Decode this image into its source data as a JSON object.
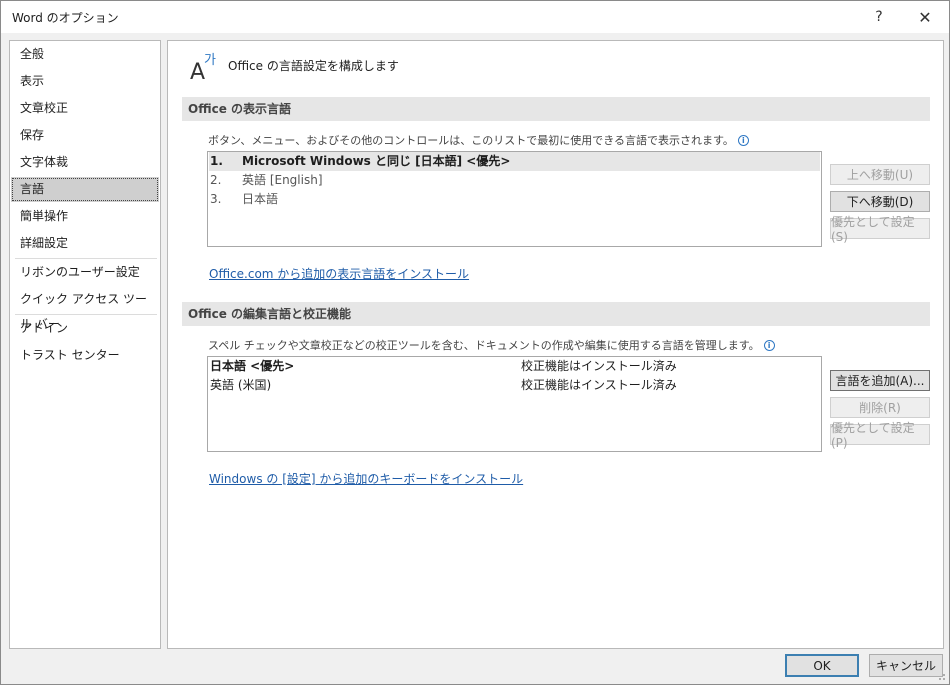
{
  "window": {
    "title": "Word のオプション",
    "help": "?",
    "close": "✕"
  },
  "sidebar": {
    "items": [
      {
        "label": "全般"
      },
      {
        "label": "表示"
      },
      {
        "label": "文章校正"
      },
      {
        "label": "保存"
      },
      {
        "label": "文字体裁"
      },
      {
        "label": "言語",
        "selected": true
      },
      {
        "label": "簡単操作"
      },
      {
        "label": "詳細設定"
      },
      {
        "label": "リボンのユーザー設定"
      },
      {
        "label": "クイック アクセス ツール バー"
      },
      {
        "label": "アドイン"
      },
      {
        "label": "トラスト センター"
      }
    ]
  },
  "main": {
    "header_icon_text": "A가",
    "header_title": "Office の言語設定を構成します",
    "display_section": {
      "title": "Office の表示言語",
      "description": "ボタン、メニュー、およびその他のコントロールは、このリストで最初に使用できる言語で表示されます。",
      "items": [
        {
          "num": "1.",
          "label": "Microsoft Windows と同じ [日本語] <優先>"
        },
        {
          "num": "2.",
          "label": "英語 [English]"
        },
        {
          "num": "3.",
          "label": "日本語"
        }
      ],
      "buttons": {
        "up": "上へ移動(U)",
        "down": "下へ移動(D)",
        "set_pref": "優先として設定(S)"
      },
      "link": "Office.com から追加の表示言語をインストール"
    },
    "edit_section": {
      "title": "Office の編集言語と校正機能",
      "description": "スペル チェックや文章校正などの校正ツールを含む、ドキュメントの作成や編集に使用する言語を管理します。",
      "items": [
        {
          "lang": "日本語 <優先>",
          "status": "校正機能はインストール済み"
        },
        {
          "lang": "英語 (米国)",
          "status": "校正機能はインストール済み"
        }
      ],
      "buttons": {
        "add": "言語を追加(A)...",
        "remove": "削除(R)",
        "set_pref": "優先として設定(P)"
      },
      "link": "Windows の [設定] から追加のキーボードをインストール"
    }
  },
  "footer": {
    "ok": "OK",
    "cancel": "キャンセル"
  },
  "colors": {
    "link": "#1f5ca8",
    "selected_bg": "#cfcfcf",
    "section_bg": "#e6e6e6",
    "ok_border": "#3c7fb1"
  }
}
